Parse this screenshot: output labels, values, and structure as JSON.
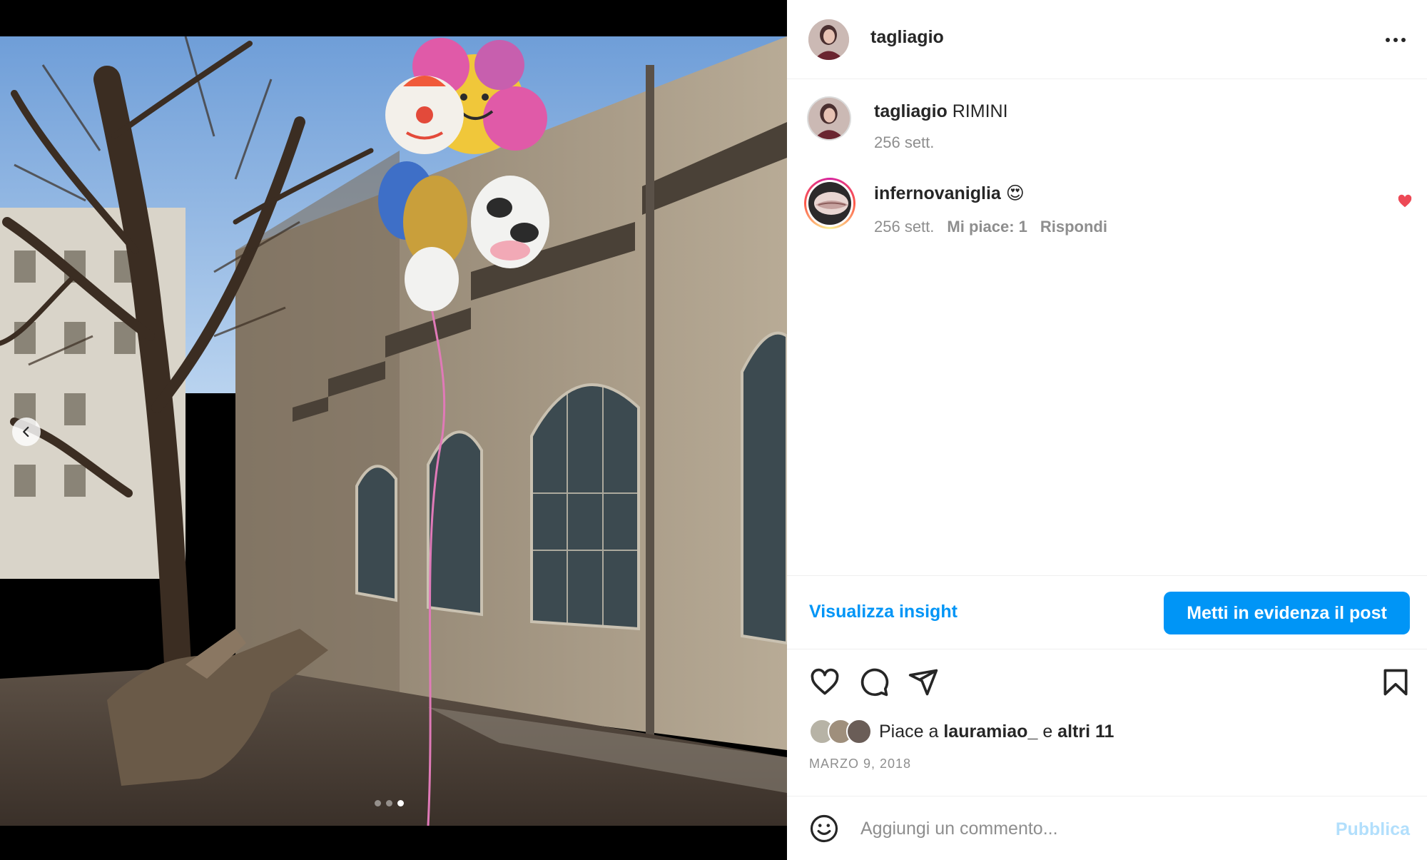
{
  "post": {
    "username": "tagliagio",
    "caption_user": "tagliagio",
    "caption_text": "RIMINI",
    "caption_time": "256 sett.",
    "comments": [
      {
        "username": "infernovaniglia",
        "text": "😍",
        "time": "256 sett.",
        "likes": "Mi piace: 1",
        "reply": "Rispondi"
      }
    ],
    "insight_link": "Visualizza insight",
    "promote_button": "Metti in evidenza il post",
    "likes_prefix": "Piace a",
    "likes_user": "lauramiao_",
    "likes_joiner": "e",
    "likes_others": "altri 11",
    "date": "MARZO 9, 2018",
    "comment_placeholder": "Aggiungi un commento...",
    "publish_label": "Pubblica"
  },
  "carousel": {
    "total": 3,
    "active_index": 3
  },
  "colors": {
    "accent": "#0095f6",
    "heart_red": "#ed4956",
    "muted_text": "#8e8e8e",
    "publish_disabled": "#b2dffc"
  },
  "icons": [
    "chevron-left-icon",
    "more-horizontal-icon",
    "heart-icon",
    "comment-icon",
    "share-icon",
    "bookmark-icon",
    "emoji-icon"
  ]
}
